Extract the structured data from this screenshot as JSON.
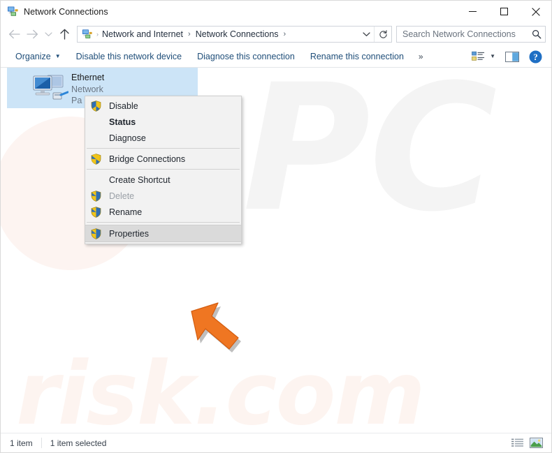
{
  "window": {
    "title": "Network Connections",
    "icon": "network-connections-icon",
    "controls": {
      "minimize": "Minimize",
      "maximize": "Maximize",
      "close": "Close"
    }
  },
  "nav": {
    "back": "Back",
    "forward": "Forward",
    "recent": "Recent locations",
    "up": "Up",
    "address_icon": "network-connections-icon",
    "breadcrumbs": [
      "Network and Internet",
      "Network Connections"
    ],
    "separator": "›",
    "dropdown": "Previous locations",
    "refresh": "Refresh"
  },
  "search": {
    "placeholder": "Search Network Connections",
    "value": "",
    "icon": "search-icon"
  },
  "toolbar": {
    "organize": "Organize",
    "disable_device": "Disable this network device",
    "diagnose_connection": "Diagnose this connection",
    "rename_connection": "Rename this connection",
    "overflow": "»",
    "change_view": "change-view-icon",
    "preview_pane": "preview-pane-icon",
    "help": "help-icon"
  },
  "list": {
    "items": [
      {
        "name": "Ethernet",
        "network": "Network",
        "adapter": "Pa",
        "icon": "ethernet-adapter-icon",
        "selected": true
      }
    ]
  },
  "context_menu": {
    "items": [
      {
        "label": "Disable",
        "shield": true,
        "bold": false,
        "disabled": false,
        "hover": false,
        "sep_after": false
      },
      {
        "label": "Status",
        "shield": false,
        "bold": true,
        "disabled": false,
        "hover": false,
        "sep_after": false
      },
      {
        "label": "Diagnose",
        "shield": false,
        "bold": false,
        "disabled": false,
        "hover": false,
        "sep_after": true
      },
      {
        "label": "Bridge Connections",
        "shield": true,
        "bold": false,
        "disabled": false,
        "hover": false,
        "sep_after": true
      },
      {
        "label": "Create Shortcut",
        "shield": false,
        "bold": false,
        "disabled": false,
        "hover": false,
        "sep_after": false
      },
      {
        "label": "Delete",
        "shield": true,
        "bold": false,
        "disabled": true,
        "hover": false,
        "sep_after": false
      },
      {
        "label": "Rename",
        "shield": true,
        "bold": false,
        "disabled": false,
        "hover": false,
        "sep_after": true
      },
      {
        "label": "Properties",
        "shield": true,
        "bold": false,
        "disabled": false,
        "hover": true,
        "sep_after": false
      }
    ]
  },
  "statusbar": {
    "item_count": "1 item",
    "selection": "1 item selected",
    "details_view": "details-view-icon",
    "large_icons_view": "large-icons-view-icon"
  },
  "watermarks": {
    "primary": "PC",
    "secondary": "risk.com"
  },
  "cursor": {
    "icon": "arrow-cursor-icon",
    "color": "#ef7622"
  },
  "colors": {
    "selection": "#cce4f7",
    "link": "#1f4e79",
    "menu_bg": "#f2f2f2",
    "menu_hover": "#dadada",
    "accent": "#ef7622"
  }
}
